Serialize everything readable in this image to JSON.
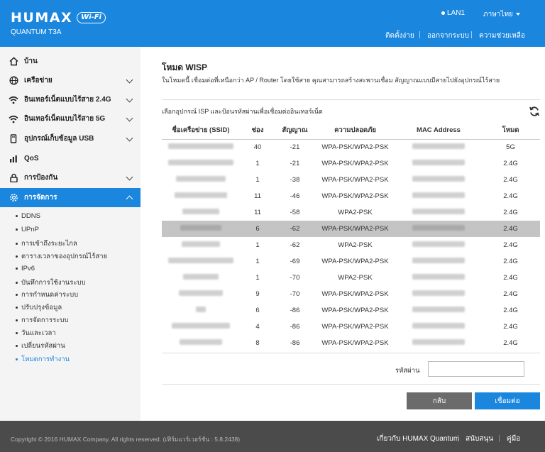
{
  "header": {
    "logo": "HUMAX",
    "logo_badge": "Wi-Fi",
    "model": "QUANTUM T3A",
    "lan_status": "LAN1",
    "language": "ภาษาไทย",
    "nav": [
      "ติดตั้งง่าย",
      "ออกจากระบบ",
      "ความช่วยเหลือ"
    ]
  },
  "sidebar": {
    "items": [
      {
        "label": "บ้าน",
        "icon": "home-icon"
      },
      {
        "label": "เครือข่าย",
        "icon": "globe-icon"
      },
      {
        "label": "อินเทอร์เน็ตแบบไร้สาย 2.4G",
        "icon": "wifi-icon"
      },
      {
        "label": "อินเทอร์เน็ตแบบไร้สาย 5G",
        "icon": "wifi-icon"
      },
      {
        "label": "อุปกรณ์เก็บข้อมูล USB",
        "icon": "usb-icon"
      },
      {
        "label": "QoS",
        "icon": "bar-chart-icon"
      },
      {
        "label": "การป้องกัน",
        "icon": "lock-icon"
      },
      {
        "label": "การจัดการ",
        "icon": "gear-icon"
      }
    ],
    "sub_items": [
      "DDNS",
      "UPnP",
      "การเข้าถึงระยะไกล",
      "ตารางเวลาของอุปกรณ์ไร้สาย",
      "IPv6",
      "บันทึกการใช้งานระบบ",
      "การกำหนดค่าระบบ",
      "ปรับปรุงข้อมูล",
      "การจัดการระบบ",
      "วันและเวลา",
      "เปลี่ยนรหัสผ่าน",
      "โหมดการทำงาน"
    ]
  },
  "main": {
    "title": "โหมด WISP",
    "description": "ในโหมดนี้ เชื่อมต่อที่เหนือกว่า AP / Router โดยใช้สาย คุณสามารถสร้างสะพานเชื่อม สัญญาณแบบมีสายไปยังอุปกรณ์ไร้สาย",
    "section_label": "เลือกอุปกรณ์ ISP และป้อนรหัสผ่านเพื่อเชื่อมต่ออินเทอร์เน็ต",
    "table": {
      "headers": [
        "ชื่อเครือข่าย (SSID)",
        "ช่อง",
        "สัญญาณ",
        "ความปลอดภัย",
        "MAC Address",
        "โหมด"
      ],
      "rows": [
        {
          "channel": "40",
          "signal": "-21",
          "security": "WPA-PSK/WPA2-PSK",
          "mode": "5G"
        },
        {
          "channel": "1",
          "signal": "-21",
          "security": "WPA-PSK/WPA2-PSK",
          "mode": "2.4G"
        },
        {
          "channel": "1",
          "signal": "-38",
          "security": "WPA-PSK/WPA2-PSK",
          "mode": "2.4G"
        },
        {
          "channel": "11",
          "signal": "-46",
          "security": "WPA-PSK/WPA2-PSK",
          "mode": "2.4G"
        },
        {
          "channel": "11",
          "signal": "-58",
          "security": "WPA2-PSK",
          "mode": "2.4G"
        },
        {
          "channel": "6",
          "signal": "-62",
          "security": "WPA-PSK/WPA2-PSK",
          "mode": "2.4G"
        },
        {
          "channel": "1",
          "signal": "-62",
          "security": "WPA2-PSK",
          "mode": "2.4G"
        },
        {
          "channel": "1",
          "signal": "-69",
          "security": "WPA-PSK/WPA2-PSK",
          "mode": "2.4G"
        },
        {
          "channel": "1",
          "signal": "-70",
          "security": "WPA2-PSK",
          "mode": "2.4G"
        },
        {
          "channel": "9",
          "signal": "-70",
          "security": "WPA-PSK/WPA2-PSK",
          "mode": "2.4G"
        },
        {
          "channel": "6",
          "signal": "-86",
          "security": "WPA-PSK/WPA2-PSK",
          "mode": "2.4G"
        },
        {
          "channel": "4",
          "signal": "-86",
          "security": "WPA-PSK/WPA2-PSK",
          "mode": "2.4G"
        },
        {
          "channel": "8",
          "signal": "-86",
          "security": "WPA-PSK/WPA2-PSK",
          "mode": "2.4G"
        }
      ]
    },
    "password_label": "รหัสผ่าน",
    "password_value": "",
    "back_button": "กลับ",
    "connect_button": "เชื่อมต่อ"
  },
  "footer": {
    "copyright": "Copyright © 2016 HUMAX Company. All rights reserved. (เฟิร์มแวร์เวอร์ชัน : 5.8.2438)",
    "links": [
      "เกี่ยวกับ HUMAX Quantum",
      "สนับสนุน",
      "คู่มือ"
    ]
  },
  "colors": {
    "accent": "#1a86de",
    "footer": "#4b4b4b",
    "selected_row": "#c4c4c4",
    "back_button": "#6b6b6b"
  }
}
